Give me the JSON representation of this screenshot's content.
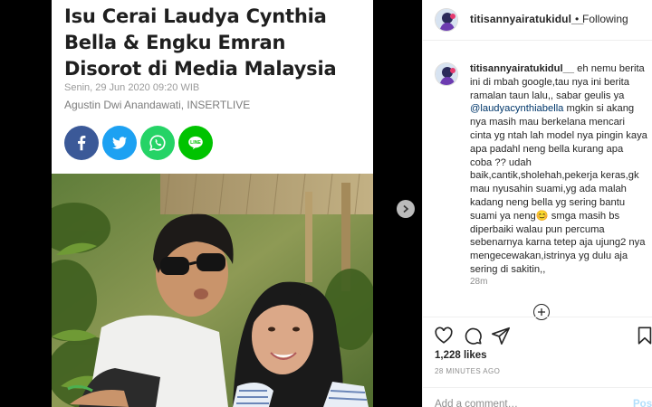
{
  "article": {
    "headline": "Isu Cerai Laudya Cynthia Bella & Engku Emran Disorot di Media Malaysia",
    "date": "Senin, 29 Jun 2020 09:20 WIB",
    "author": "Agustin Dwi Anandawati, INSERTLIVE",
    "share_buttons": [
      {
        "icon": "facebook-icon",
        "color": "#3b5998"
      },
      {
        "icon": "twitter-icon",
        "color": "#1da1f2"
      },
      {
        "icon": "whatsapp-icon",
        "color": "#25d366"
      },
      {
        "icon": "line-icon",
        "color": "#00c300"
      }
    ]
  },
  "header": {
    "username": "titisannyairatukidul__",
    "separator": "•",
    "follow_status": "Following"
  },
  "caption": {
    "username": "titisannyairatukidul__",
    "text_part1": " eh nemu berita ini di mbah google,tau nya ini berita ramalan taun lalu,, sabar geulis ya ",
    "mention": "@laudyacynthiabella",
    "text_part2": " mgkin si akang nya masih mau berkelana mencari cinta yg ntah lah model nya pingin kaya apa padahl neng bella kurang apa coba ?? udah baik,cantik,sholehah,pekerja keras,gk mau nyusahin suami,yg ada malah kadang neng bella yg sering bantu suami ya neng😊 smga masih bs diperbaiki walau pun percuma sebenarnya karna tetep aja ujung2 nya mengecewakan,istrinya yg dulu aja sering di sakitin,,",
    "time": "28m"
  },
  "post": {
    "likes": "1,228 likes",
    "time": "28 MINUTES AGO",
    "comment_placeholder": "Add a comment…",
    "post_label": "Post"
  },
  "colors": {
    "accent": "#0095f6",
    "mention": "#00376b",
    "muted": "#8e8e8e"
  }
}
